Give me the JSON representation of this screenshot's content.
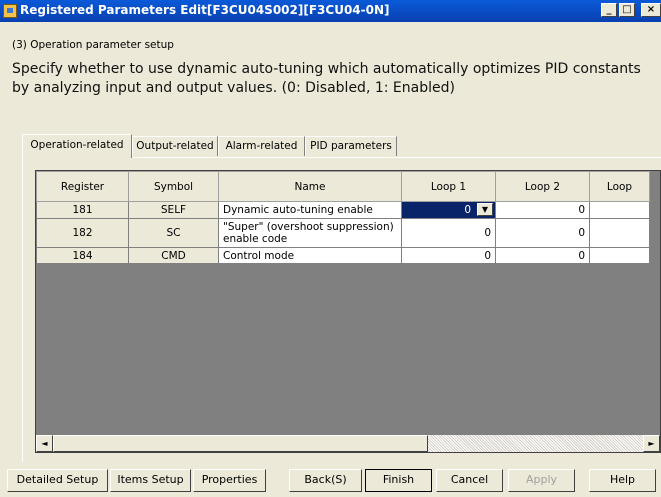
{
  "window": {
    "title": "Registered Parameters Edit[F3CU04S002][F3CU04-0N]",
    "controls": {
      "minimize": "_",
      "maximize": "□",
      "close": "×"
    }
  },
  "section": "(3) Operation parameter setup",
  "description": "Specify whether to use dynamic auto-tuning which automatically optimizes PID constants by analyzing input and output values. (0: Disabled, 1: Enabled)",
  "tabs": [
    {
      "label": "Operation-related",
      "active": true
    },
    {
      "label": "Output-related",
      "active": false
    },
    {
      "label": "Alarm-related",
      "active": false
    },
    {
      "label": "PID parameters",
      "active": false
    }
  ],
  "table": {
    "columns": [
      "Register",
      "Symbol",
      "Name",
      "Loop 1",
      "Loop 2",
      "Loop"
    ],
    "rows": [
      {
        "register": "181",
        "symbol": "SELF",
        "name": "Dynamic auto-tuning enable",
        "loop1": "0",
        "loop2": "0"
      },
      {
        "register": "182",
        "symbol": "SC",
        "name": "\"Super\" (overshoot suppression) enable code",
        "loop1": "0",
        "loop2": "0"
      },
      {
        "register": "184",
        "symbol": "CMD",
        "name": "Control mode",
        "loop1": "0",
        "loop2": "0"
      }
    ]
  },
  "scrollbar": {
    "left_arrow": "◄",
    "right_arrow": "►"
  },
  "buttons": {
    "detailed_setup": "Detailed Setup",
    "items_setup": "Items Setup",
    "properties": "Properties",
    "back": "Back(S)",
    "finish": "Finish",
    "cancel": "Cancel",
    "apply": "Apply",
    "help": "Help"
  },
  "dropdown_arrow": "▼",
  "colors": {
    "titlebar": "#0a5ad8",
    "selection": "#0a246a",
    "face": "#ece9d8"
  }
}
